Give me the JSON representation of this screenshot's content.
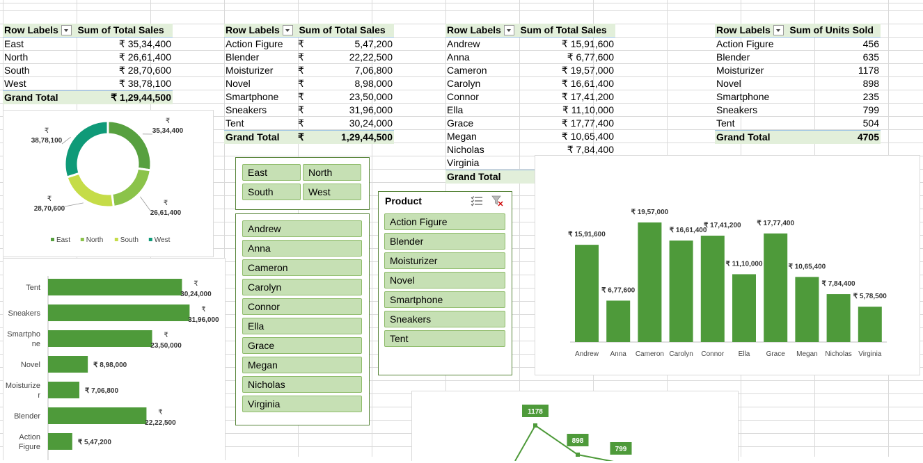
{
  "pivot_region": {
    "header_row": "Row Labels",
    "header_val": "Sum of Total Sales",
    "rows": [
      {
        "label": "East",
        "value": "₹ 35,34,400"
      },
      {
        "label": "North",
        "value": "₹ 26,61,400"
      },
      {
        "label": "South",
        "value": "₹ 28,70,600"
      },
      {
        "label": "West",
        "value": "₹ 38,78,100"
      }
    ],
    "total_label": "Grand Total",
    "total_value": "₹ 1,29,44,500"
  },
  "pivot_product": {
    "header_row": "Row Labels",
    "header_val": "Sum of Total Sales",
    "currency": "₹",
    "rows": [
      {
        "label": "Action Figure",
        "value": "5,47,200"
      },
      {
        "label": "Blender",
        "value": "22,22,500"
      },
      {
        "label": "Moisturizer",
        "value": "7,06,800"
      },
      {
        "label": "Novel",
        "value": "8,98,000"
      },
      {
        "label": "Smartphone",
        "value": "23,50,000"
      },
      {
        "label": "Sneakers",
        "value": "31,96,000"
      },
      {
        "label": "Tent",
        "value": "30,24,000"
      }
    ],
    "total_label": "Grand Total",
    "total_value": "1,29,44,500"
  },
  "pivot_customer": {
    "header_row": "Row Labels",
    "header_val": "Sum of Total Sales",
    "rows": [
      {
        "label": "Andrew",
        "value": "₹ 15,91,600"
      },
      {
        "label": "Anna",
        "value": "₹ 6,77,600"
      },
      {
        "label": "Cameron",
        "value": "₹ 19,57,000"
      },
      {
        "label": "Carolyn",
        "value": "₹ 16,61,400"
      },
      {
        "label": "Connor",
        "value": "₹ 17,41,200"
      },
      {
        "label": "Ella",
        "value": "₹ 11,10,000"
      },
      {
        "label": "Grace",
        "value": "₹ 17,77,400"
      },
      {
        "label": "Megan",
        "value": "₹ 10,65,400"
      },
      {
        "label": "Nicholas",
        "value": "₹ 7,84,400"
      },
      {
        "label": "Virginia",
        "value": ""
      }
    ],
    "total_label": "Grand Total"
  },
  "pivot_units": {
    "header_row": "Row Labels",
    "header_val": "Sum of Units Sold",
    "rows": [
      {
        "label": "Action Figure",
        "value": "456"
      },
      {
        "label": "Blender",
        "value": "635"
      },
      {
        "label": "Moisturizer",
        "value": "1178"
      },
      {
        "label": "Novel",
        "value": "898"
      },
      {
        "label": "Smartphone",
        "value": "235"
      },
      {
        "label": "Sneakers",
        "value": "799"
      },
      {
        "label": "Tent",
        "value": "504"
      }
    ],
    "total_label": "Grand Total",
    "total_value": "4705"
  },
  "slicer_region": {
    "items": [
      "East",
      "North",
      "South",
      "West"
    ]
  },
  "slicer_customer": {
    "items": [
      "Andrew",
      "Anna",
      "Cameron",
      "Carolyn",
      "Connor",
      "Ella",
      "Grace",
      "Megan",
      "Nicholas",
      "Virginia"
    ]
  },
  "slicer_product": {
    "title": "Product",
    "items": [
      "Action Figure",
      "Blender",
      "Moisturizer",
      "Novel",
      "Smartphone",
      "Sneakers",
      "Tent"
    ]
  },
  "chart_data": [
    {
      "type": "pie",
      "categories": [
        "East",
        "North",
        "South",
        "West"
      ],
      "values": [
        3534400,
        2661400,
        2870600,
        3878100
      ],
      "labels": [
        "₹ 35,34,400",
        "₹ 26,61,400",
        "₹ 28,70,600",
        "₹ 38,78,100"
      ],
      "colors": [
        "#57a03f",
        "#8bc34a",
        "#c5dc48",
        "#0f9a78"
      ],
      "legend": "bottom"
    },
    {
      "type": "bar",
      "orientation": "horizontal",
      "categories": [
        "Tent",
        "Sneakers",
        "Smartphone",
        "Novel",
        "Moisturizer",
        "Blender",
        "Action Figure"
      ],
      "values": [
        3024000,
        3196000,
        2350000,
        898000,
        706800,
        2222500,
        547200
      ],
      "labels": [
        "₹ 30,24,000",
        "₹ 31,96,000",
        "₹ 23,50,000",
        "₹ 8,98,000",
        "₹ 7,06,800",
        "₹ 22,22,500",
        "₹ 5,47,200"
      ],
      "color": "#4e9a3a"
    },
    {
      "type": "bar",
      "categories": [
        "Andrew",
        "Anna",
        "Cameron",
        "Carolyn",
        "Connor",
        "Ella",
        "Grace",
        "Megan",
        "Nicholas",
        "Virginia"
      ],
      "values": [
        1591600,
        677600,
        1957000,
        1661400,
        1741200,
        1110000,
        1777400,
        1065400,
        784400,
        578500
      ],
      "labels": [
        "₹ 15,91,600",
        "₹ 6,77,600",
        "₹ 19,57,000",
        "₹ 16,61,400",
        "₹ 17,41,200",
        "₹ 11,10,000",
        "₹ 17,77,400",
        "₹ 10,65,400",
        "₹ 7,84,400",
        "₹ 5,78,500"
      ],
      "color": "#4e9a3a"
    },
    {
      "type": "line",
      "values": [
        1178,
        898,
        799
      ],
      "labels": [
        "1178",
        "898",
        "799"
      ],
      "color": "#4e9a3a"
    }
  ]
}
